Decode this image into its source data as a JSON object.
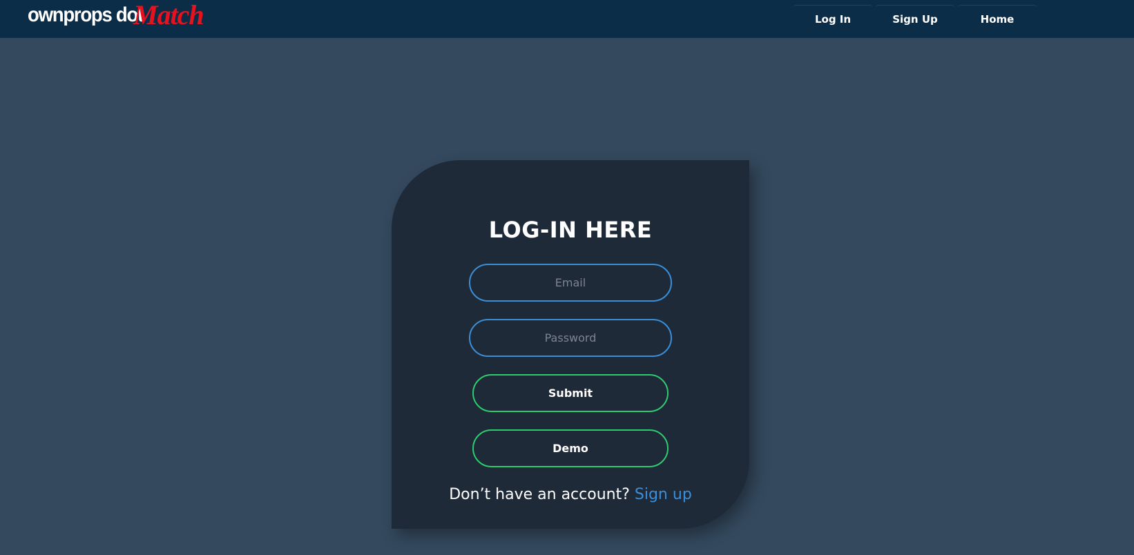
{
  "brand": {
    "name_main": "ownprops dot",
    "name_accent": "Match",
    "accent_color": "#e8121e"
  },
  "nav": {
    "links": [
      {
        "label": "Log In"
      },
      {
        "label": "Sign Up"
      },
      {
        "label": "Home"
      }
    ]
  },
  "login": {
    "title": "LOG-IN HERE",
    "email_placeholder": "Email",
    "password_placeholder": "Password",
    "submit_label": "Submit",
    "demo_label": "Demo",
    "no_account_text": "Don’t have an account?",
    "signup_link": "Sign up"
  },
  "colors": {
    "background": "#34495e",
    "navbar": "#0c2d48",
    "card": "#1f2a38",
    "input_border": "#3b8fd9",
    "button_border": "#2ecc71"
  }
}
